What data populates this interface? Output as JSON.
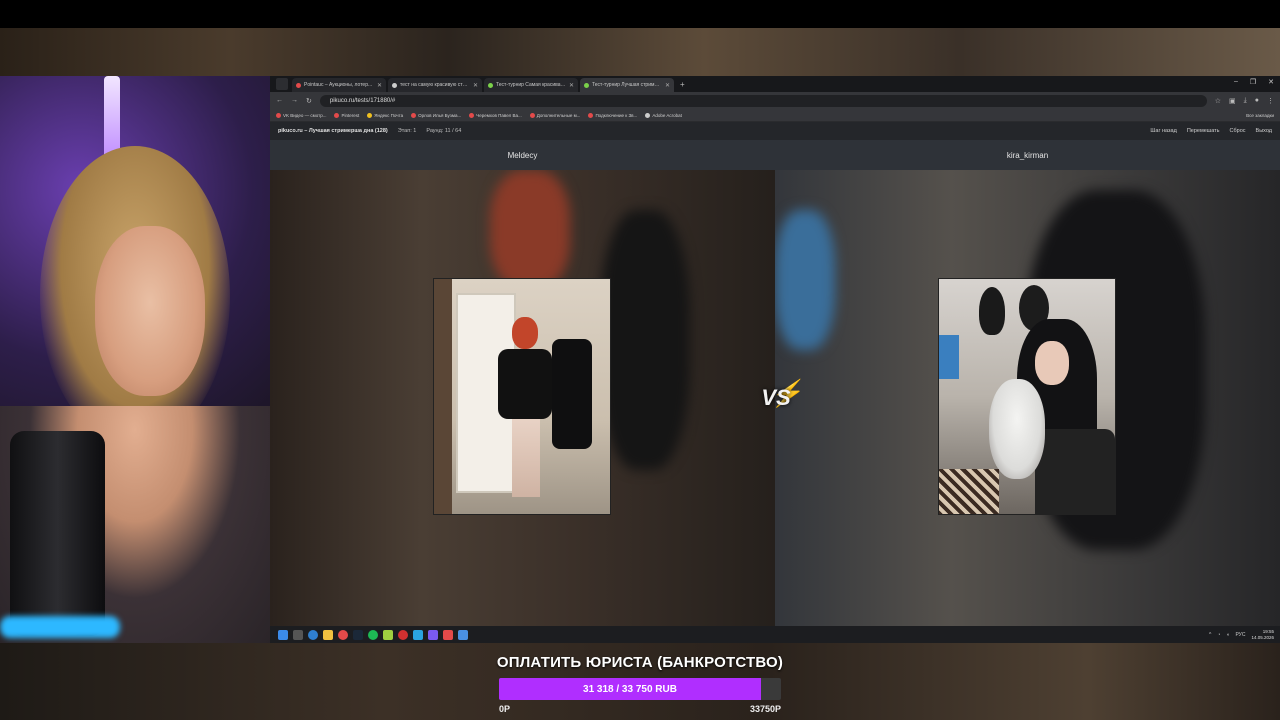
{
  "browser": {
    "tabs": [
      {
        "title": "Pointauc – Аукционы, лотер...",
        "active": false,
        "favicon_color": "#e34a4a"
      },
      {
        "title": "тест на самую красивую стри...",
        "active": false,
        "favicon_color": "#cccccc"
      },
      {
        "title": "Тест-турнир Самая красивая...",
        "active": false,
        "favicon_color": "#7bd14a"
      },
      {
        "title": "Тест-турнир Лучшая стримерш...",
        "active": true,
        "favicon_color": "#7bd14a"
      }
    ],
    "new_tab": "+",
    "window_controls": [
      "–",
      "❐",
      "✕"
    ],
    "url": "pikuco.ru/tests/171880/#",
    "bookmarks": [
      {
        "label": "VK Видео — смотр...",
        "color": "#e34a4a"
      },
      {
        "label": "Pinterest",
        "color": "#e34a4a"
      },
      {
        "label": "Яндекс Почта",
        "color": "#f0c020"
      },
      {
        "label": "Орлов Илья Бузма...",
        "color": "#e34a4a"
      },
      {
        "label": "Черемхов Павел Ва...",
        "color": "#e34a4a"
      },
      {
        "label": "Дополнительные м...",
        "color": "#e34a4a"
      },
      {
        "label": "Подключение к Зв...",
        "color": "#e34a4a"
      },
      {
        "label": "Adobe Acrobat",
        "color": "#cccccc"
      }
    ],
    "bookmarks_all": "Все закладки"
  },
  "site": {
    "title": "pikuco.ru – Лучшая стримерша дна (128)",
    "stage": "Этап: 1",
    "round": "Раунд: 11 / 64",
    "actions": [
      "Шаг назад",
      "Перемешать",
      "Сброс",
      "Выход"
    ]
  },
  "contest": {
    "left_name": "Meldecy",
    "right_name": "kira_kirman",
    "vs_label": "VS"
  },
  "taskbar": {
    "tray_lang": "РУС",
    "time": "19:55",
    "date": "14.05.2026"
  },
  "goal": {
    "title": "ОПЛАТИТЬ ЮРИСТА (БАНКРОТСТВО)",
    "progress_text": "31 318 / 33 750 RUB",
    "current": 31318,
    "target": 33750,
    "min_label": "0Р",
    "max_label": "33750Р",
    "fill_color": "#b02eff"
  }
}
